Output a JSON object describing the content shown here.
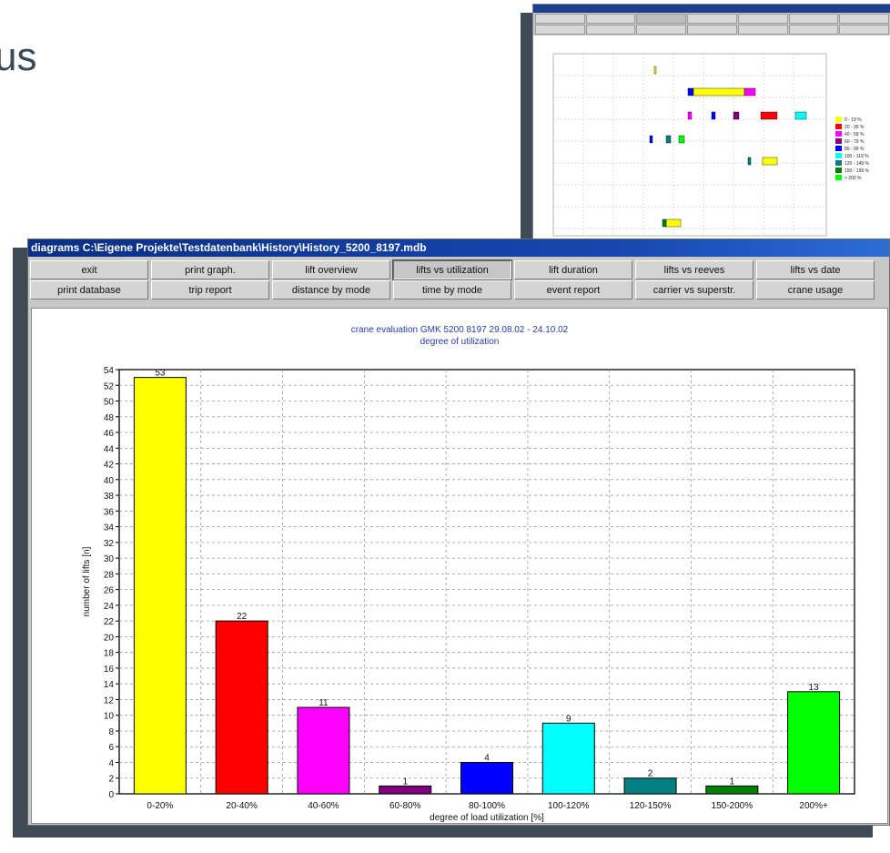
{
  "slide": {
    "title_fragment": "us"
  },
  "thumbnail": {
    "legend": [
      {
        "label": "0 - 19 %",
        "color": "#ffff00"
      },
      {
        "label": "20 - 39 %",
        "color": "#ff0000"
      },
      {
        "label": "40 - 59 %",
        "color": "#ff00ff"
      },
      {
        "label": "60 - 79 %",
        "color": "#800080"
      },
      {
        "label": "80 - 99 %",
        "color": "#0000ff"
      },
      {
        "label": "100 - 119 %",
        "color": "#00ffff"
      },
      {
        "label": "120 - 149 %",
        "color": "#008080"
      },
      {
        "label": "150 - 199 %",
        "color": "#008000"
      },
      {
        "label": "> 200 %",
        "color": "#00ff00"
      }
    ]
  },
  "window": {
    "title": "diagrams C:\\Eigene Projekte\\Testdatenbank\\History\\History_5200_8197.mdb"
  },
  "toolbar": {
    "buttons": [
      "exit",
      "print graph.",
      "lift overview",
      "lifts vs utilization",
      "lift duration",
      "lifts vs reeves",
      "lifts vs date",
      "print database",
      "trip report",
      "distance by mode",
      "time by mode",
      "event report",
      "carrier vs superstr.",
      "crane usage"
    ],
    "active": "lifts vs utilization"
  },
  "chart_data": {
    "type": "bar",
    "title": "crane evaluation GMK 5200 8197    29.08.02 - 24.10.02",
    "subtitle": "degree of utilization",
    "xlabel": "degree of load utilization [%]",
    "ylabel": "number of lifts [n]",
    "ylim": [
      0,
      54
    ],
    "yticks": [
      0,
      2,
      4,
      6,
      8,
      10,
      12,
      14,
      16,
      18,
      20,
      22,
      24,
      26,
      28,
      30,
      32,
      34,
      36,
      38,
      40,
      42,
      44,
      46,
      48,
      50,
      52,
      54
    ],
    "grid": true,
    "categories": [
      "0-20%",
      "20-40%",
      "40-60%",
      "60-80%",
      "80-100%",
      "100-120%",
      "120-150%",
      "150-200%",
      "200%+"
    ],
    "values": [
      53,
      22,
      11,
      1,
      4,
      9,
      2,
      1,
      13
    ],
    "colors": [
      "#ffff00",
      "#ff0000",
      "#ff00ff",
      "#800080",
      "#0000ff",
      "#00ffff",
      "#008080",
      "#008000",
      "#00ff00"
    ]
  }
}
